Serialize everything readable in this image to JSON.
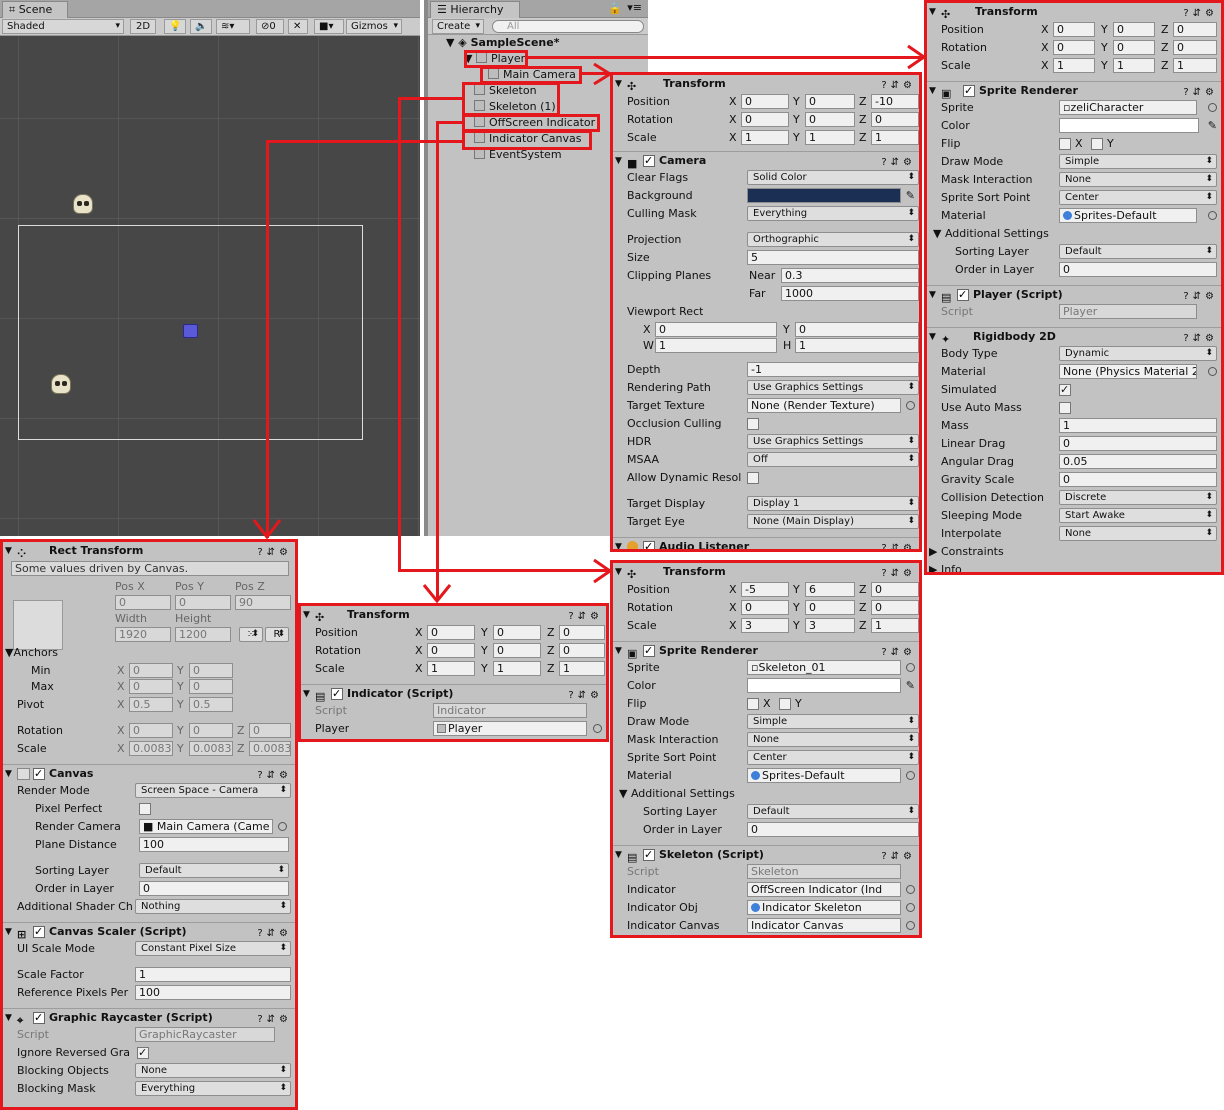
{
  "scene": {
    "tab": "Scene",
    "shading": "Shaded",
    "mode2d": "2D",
    "hidden_count": "0",
    "gizmos": "Gizmos",
    "search_placeholder": "All"
  },
  "hierarchy": {
    "tab": "Hierarchy",
    "create": "Create",
    "search_placeholder": "All",
    "scene_name": "SampleScene*",
    "items": [
      "Player",
      "Main Camera",
      "Skeleton",
      "Skeleton (1)",
      "OffScreen Indicator",
      "Indicator Canvas",
      "EventSystem"
    ]
  },
  "player_panel": {
    "transform": {
      "title": "Transform",
      "position": [
        "0",
        "0",
        "0"
      ],
      "rotation": [
        "0",
        "0",
        "0"
      ],
      "scale": [
        "1",
        "1",
        "1"
      ]
    },
    "sprite_renderer": {
      "title": "Sprite Renderer",
      "sprite": "zeliCharacter",
      "color_label": "Color",
      "flip_label": "Flip",
      "draw_mode": "Simple",
      "mask_interaction": "None",
      "sort_point": "Center",
      "material": "Sprites-Default",
      "additional": "Additional Settings",
      "sorting_layer": "Default",
      "order": "0"
    },
    "player_script": {
      "title": "Player (Script)",
      "script": "Player"
    },
    "rigidbody": {
      "title": "Rigidbody 2D",
      "body_type": "Dynamic",
      "material": "None (Physics Material 2",
      "mass": "1",
      "linear_drag": "0",
      "angular_drag": "0.05",
      "gravity": "0",
      "collision": "Discrete",
      "sleeping": "Start Awake",
      "interpolate": "None",
      "constraints": "Constraints",
      "info": "Info"
    }
  },
  "camera_panel": {
    "transform": {
      "title": "Transform",
      "position": [
        "0",
        "0",
        "-10"
      ],
      "rotation": [
        "0",
        "0",
        "0"
      ],
      "scale": [
        "1",
        "1",
        "1"
      ]
    },
    "camera": {
      "title": "Camera",
      "clear_flags": "Solid Color",
      "culling_mask": "Everything",
      "projection": "Orthographic",
      "size": "5",
      "near": "0.3",
      "far": "1000",
      "vp_x": "0",
      "vp_y": "0",
      "vp_w": "1",
      "vp_h": "1",
      "depth": "-1",
      "rendering_path": "Use Graphics Settings",
      "target_texture": "None (Render Texture)",
      "hdr": "Use Graphics Settings",
      "msaa": "Off",
      "target_display": "Display 1",
      "target_eye": "None (Main Display)",
      "background_color": "#1b2e54"
    },
    "audio": "Audio Listener"
  },
  "skeleton_panel": {
    "transform": {
      "title": "Transform",
      "position": [
        "-5",
        "6",
        "0"
      ],
      "rotation": [
        "0",
        "0",
        "0"
      ],
      "scale": [
        "3",
        "3",
        "1"
      ]
    },
    "sprite_renderer": {
      "title": "Sprite Renderer",
      "sprite": "Skeleton_01",
      "draw_mode": "Simple",
      "mask_interaction": "None",
      "sort_point": "Center",
      "material": "Sprites-Default",
      "additional": "Additional Settings",
      "sorting_layer": "Default",
      "order": "0"
    },
    "script": {
      "title": "Skeleton (Script)",
      "script": "Skeleton",
      "indicator": "OffScreen Indicator (Ind",
      "indicator_obj": "Indicator Skeleton",
      "indicator_canvas": "Indicator Canvas"
    }
  },
  "indicator_panel": {
    "transform": {
      "title": "Transform",
      "position": [
        "0",
        "0",
        "0"
      ],
      "rotation": [
        "0",
        "0",
        "0"
      ],
      "scale": [
        "1",
        "1",
        "1"
      ]
    },
    "script": {
      "title": "Indicator (Script)",
      "script": "Indicator",
      "player": "Player"
    }
  },
  "canvas_panel": {
    "rect": {
      "title": "Rect Transform",
      "note": "Some values driven by Canvas.",
      "posx": "0",
      "posy": "0",
      "posz": "90",
      "width": "1920",
      "height": "1200",
      "min": [
        "0",
        "0"
      ],
      "max": [
        "0",
        "0"
      ],
      "pivot": [
        "0.5",
        "0.5"
      ],
      "rotation": [
        "0",
        "0",
        "0"
      ],
      "scale": [
        "0.0083",
        "0.0083",
        "0.0083"
      ]
    },
    "canvas": {
      "title": "Canvas",
      "render_mode": "Screen Space - Camera",
      "render_camera": "Main Camera (Came",
      "plane_distance": "100",
      "sorting_layer": "Default",
      "order": "0",
      "shader_channels": "Nothing"
    },
    "scaler": {
      "title": "Canvas Scaler (Script)",
      "ui_scale_mode": "Constant Pixel Size",
      "scale_factor": "1",
      "ref_ppu": "100"
    },
    "raycaster": {
      "title": "Graphic Raycaster (Script)",
      "script": "GraphicRaycaster",
      "blocking_objects": "None",
      "blocking_mask": "Everything"
    }
  },
  "labels": {
    "position": "Position",
    "rotation": "Rotation",
    "scale": "Scale",
    "sprite": "Sprite",
    "color": "Color",
    "flip": "Flip",
    "draw_mode": "Draw Mode",
    "mask_interaction": "Mask Interaction",
    "sort_point": "Sprite Sort Point",
    "material": "Material",
    "sorting_layer": "Sorting Layer",
    "order": "Order in Layer",
    "script": "Script",
    "body_type": "Body Type",
    "simulated": "Simulated",
    "use_auto_mass": "Use Auto Mass",
    "mass": "Mass",
    "linear_drag": "Linear Drag",
    "angular_drag": "Angular Drag",
    "gravity": "Gravity Scale",
    "collision": "Collision Detection",
    "sleeping": "Sleeping Mode",
    "interpolate": "Interpolate",
    "clear_flags": "Clear Flags",
    "background": "Background",
    "culling_mask": "Culling Mask",
    "projection": "Projection",
    "size": "Size",
    "clipping": "Clipping Planes",
    "near": "Near",
    "far": "Far",
    "viewport": "Viewport Rect",
    "depth": "Depth",
    "rendering_path": "Rendering Path",
    "target_texture": "Target Texture",
    "occlusion": "Occlusion Culling",
    "hdr": "HDR",
    "msaa": "MSAA",
    "dynamic_res": "Allow Dynamic Resol",
    "target_display": "Target Display",
    "target_eye": "Target Eye",
    "indicator": "Indicator",
    "indicator_obj": "Indicator Obj",
    "indicator_canvas": "Indicator Canvas",
    "player": "Player",
    "posx": "Pos X",
    "posy": "Pos Y",
    "posz": "Pos Z",
    "width": "Width",
    "height": "Height",
    "anchors": "Anchors",
    "min": "Min",
    "max": "Max",
    "pivot": "Pivot",
    "render_mode": "Render Mode",
    "pixel_perfect": "Pixel Perfect",
    "render_camera": "Render Camera",
    "plane_distance": "Plane Distance",
    "shader_channels": "Additional Shader Ch",
    "ui_scale_mode": "UI Scale Mode",
    "scale_factor": "Scale Factor",
    "ref_ppu": "Reference Pixels Per",
    "ignore_reversed": "Ignore Reversed Gra",
    "blocking_objects": "Blocking Objects",
    "blocking_mask": "Blocking Mask",
    "x": "X",
    "y": "Y",
    "z": "Z",
    "w": "W",
    "h": "H",
    "r": "R"
  }
}
